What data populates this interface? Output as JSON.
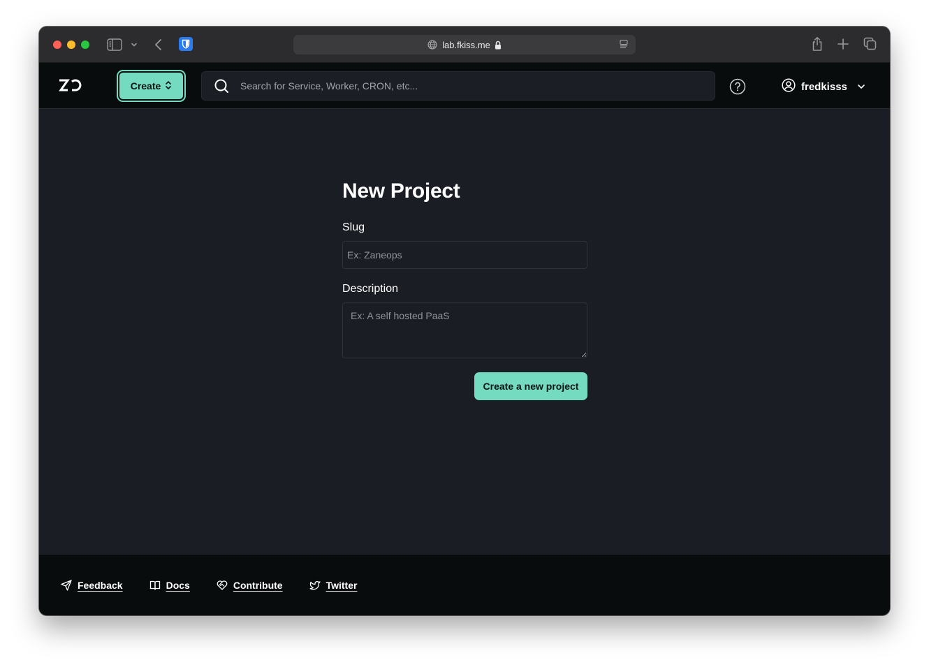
{
  "browser": {
    "url": "lab.fkiss.me",
    "colors": {
      "close": "#fe5f57",
      "minimize": "#febc2e",
      "zoom": "#28c840",
      "extension": "#2a7bf0"
    }
  },
  "header": {
    "logo": "ZO",
    "create_label": "Create",
    "search": {
      "placeholder": "Search for Service, Worker, CRON, etc..."
    },
    "user": {
      "name": "fredkisss"
    }
  },
  "form": {
    "title": "New Project",
    "slug": {
      "label": "Slug",
      "value": "",
      "placeholder": "Ex: Zaneops"
    },
    "description": {
      "label": "Description",
      "value": "",
      "placeholder": "Ex: A self hosted PaaS"
    },
    "submit_label": "Create a new project"
  },
  "footer": {
    "links": [
      {
        "label": "Feedback",
        "icon": "send-icon"
      },
      {
        "label": "Docs",
        "icon": "book-icon"
      },
      {
        "label": "Contribute",
        "icon": "heart-handshake-icon"
      },
      {
        "label": "Twitter",
        "icon": "twitter-icon"
      }
    ]
  },
  "theme": {
    "accent": "#74dbc0",
    "background": "#1b1d24",
    "header_bg": "#080c0c"
  }
}
